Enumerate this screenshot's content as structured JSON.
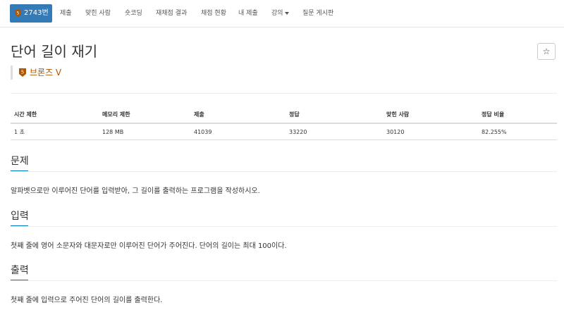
{
  "nav": {
    "problem_number": "2743번",
    "tier_digit": "5",
    "items": [
      "제출",
      "맞힌 사람",
      "숏코딩",
      "재채점 결과",
      "채점 현황",
      "내 제출",
      "강의",
      "질문 게시판"
    ]
  },
  "problem": {
    "title": "단어 길이 재기",
    "star": "☆",
    "tier_digit": "5",
    "tier_label": "브론즈 V"
  },
  "info_table": {
    "headers": [
      "시간 제한",
      "메모리 제한",
      "제출",
      "정답",
      "맞힌 사람",
      "정답 비율"
    ],
    "row": [
      "1 초",
      "128 MB",
      "41039",
      "33220",
      "30120",
      "82.255%"
    ]
  },
  "sections": [
    {
      "heading": "문제",
      "text": "알파벳으로만 이루어진 단어를 입력받아, 그 길이를 출력하는 프로그램을 작성하시오."
    },
    {
      "heading": "입력",
      "text": "첫째 줄에 영어 소문자와 대문자로만 이루어진 단어가 주어진다. 단어의 길이는 최대 100이다."
    },
    {
      "heading": "출력",
      "text": "첫째 줄에 입력으로 주어진 단어의 길이를 출력한다."
    }
  ],
  "colors": {
    "primary": "#337ab7",
    "bronze": "#ad5600",
    "section_accent": "#0076c0"
  }
}
